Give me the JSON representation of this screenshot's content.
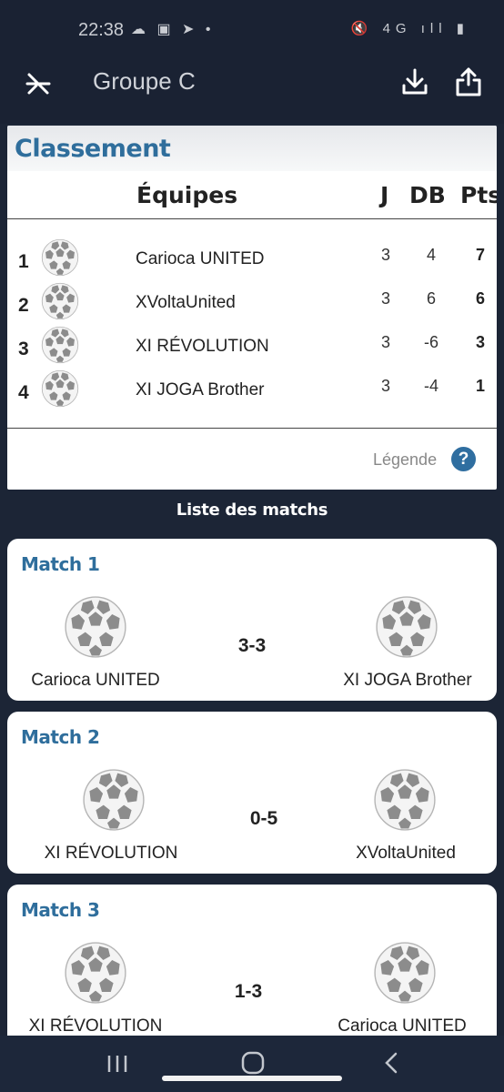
{
  "status_bar": {
    "time": "22:38",
    "left_icons": "☁ ▣ ➤ •",
    "right_icons": "🔇 4G ıll ▮"
  },
  "app_bar": {
    "title": "Groupe C",
    "close_icon": "close-back-icon",
    "download_icon": "download-icon",
    "share_icon": "share-icon"
  },
  "standings": {
    "title": "Classement",
    "columns": {
      "teams": "Équipes",
      "j": "J",
      "db": "DB",
      "pts": "Pts"
    },
    "rows": [
      {
        "rank": "1",
        "team": "Carioca UNITED",
        "j": "3",
        "db": "4",
        "pts": "7"
      },
      {
        "rank": "2",
        "team": "XVoltaUnited",
        "j": "3",
        "db": "6",
        "pts": "6"
      },
      {
        "rank": "3",
        "team": "XI RÉVOLUTION",
        "j": "3",
        "db": "-6",
        "pts": "3"
      },
      {
        "rank": "4",
        "team": "XI JOGA Brother",
        "j": "3",
        "db": "-4",
        "pts": "1"
      }
    ],
    "legend_label": "Légende",
    "help_symbol": "?"
  },
  "matches": {
    "heading": "Liste des matchs",
    "items": [
      {
        "title": "Match 1",
        "home": "Carioca UNITED",
        "away": "XI JOGA Brother",
        "score": "3-3"
      },
      {
        "title": "Match 2",
        "home": "XI RÉVOLUTION",
        "away": "XVoltaUnited",
        "score": "0-5"
      },
      {
        "title": "Match 3",
        "home": "XI RÉVOLUTION",
        "away": "Carioca UNITED",
        "score": "1-3"
      }
    ]
  },
  "colors": {
    "accent": "#2f6e9c",
    "background": "#1c2536",
    "card": "#ffffff"
  }
}
